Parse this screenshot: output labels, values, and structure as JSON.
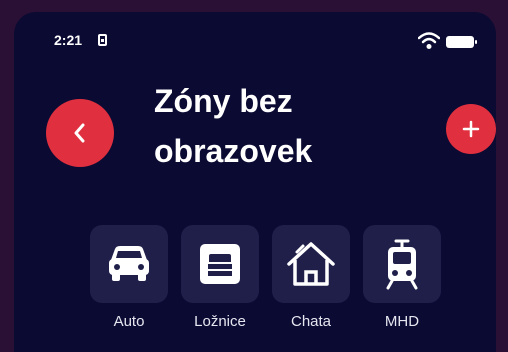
{
  "status_bar": {
    "time": "2:21"
  },
  "header": {
    "title": "Zóny bez obrazovek"
  },
  "zones": [
    {
      "label": "Auto",
      "icon": "car-icon"
    },
    {
      "label": "Ložnice",
      "icon": "bed-icon"
    },
    {
      "label": "Chata",
      "icon": "cottage-icon"
    },
    {
      "label": "MHD",
      "icon": "tram-icon"
    }
  ],
  "colors": {
    "background": "#0b0a33",
    "accent": "#e0303f",
    "tile": "#1f1f4a"
  }
}
